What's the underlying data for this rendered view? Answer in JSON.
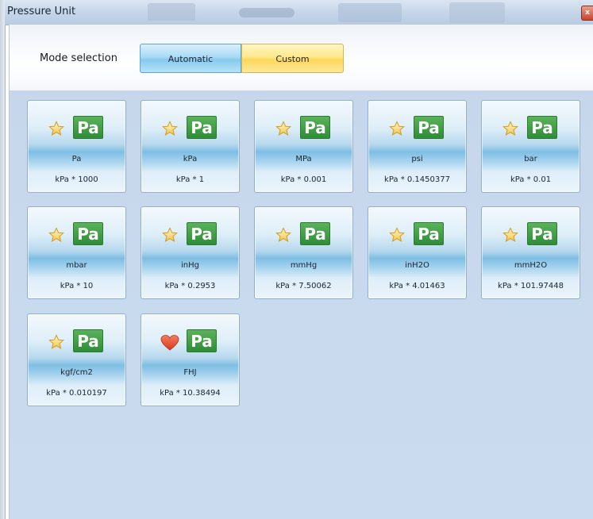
{
  "window": {
    "title": "Pressure Unit",
    "close_label": "x"
  },
  "mode": {
    "label": "Mode selection",
    "options": [
      "Automatic",
      "Custom"
    ],
    "selected": "Automatic"
  },
  "icon_badge_text": "Pa",
  "units": [
    {
      "name": "Pa",
      "formula": "kPa * 1000",
      "icon": "star-icon"
    },
    {
      "name": "kPa",
      "formula": "kPa * 1",
      "icon": "star-icon"
    },
    {
      "name": "MPa",
      "formula": "kPa * 0.001",
      "icon": "star-icon"
    },
    {
      "name": "psi",
      "formula": "kPa * 0.1450377",
      "icon": "star-icon"
    },
    {
      "name": "bar",
      "formula": "kPa * 0.01",
      "icon": "star-icon"
    },
    {
      "name": "mbar",
      "formula": "kPa * 10",
      "icon": "star-icon"
    },
    {
      "name": "inHg",
      "formula": "kPa * 0.2953",
      "icon": "star-icon"
    },
    {
      "name": "mmHg",
      "formula": "kPa * 7.50062",
      "icon": "star-icon"
    },
    {
      "name": "inH2O",
      "formula": "kPa * 4.01463",
      "icon": "star-icon"
    },
    {
      "name": "mmH2O",
      "formula": "kPa * 101.97448",
      "icon": "star-icon"
    },
    {
      "name": "kgf/cm2",
      "formula": "kPa * 0.010197",
      "icon": "star-icon"
    },
    {
      "name": "FHJ",
      "formula": "kPa * 10.38494",
      "icon": "heart-icon"
    }
  ],
  "colors": {
    "badge_green": "#2f8d37",
    "star_gold": "#f5c542",
    "heart_red": "#e0452a",
    "automatic_blue": "#86c9ee",
    "custom_yellow": "#fed75a"
  }
}
